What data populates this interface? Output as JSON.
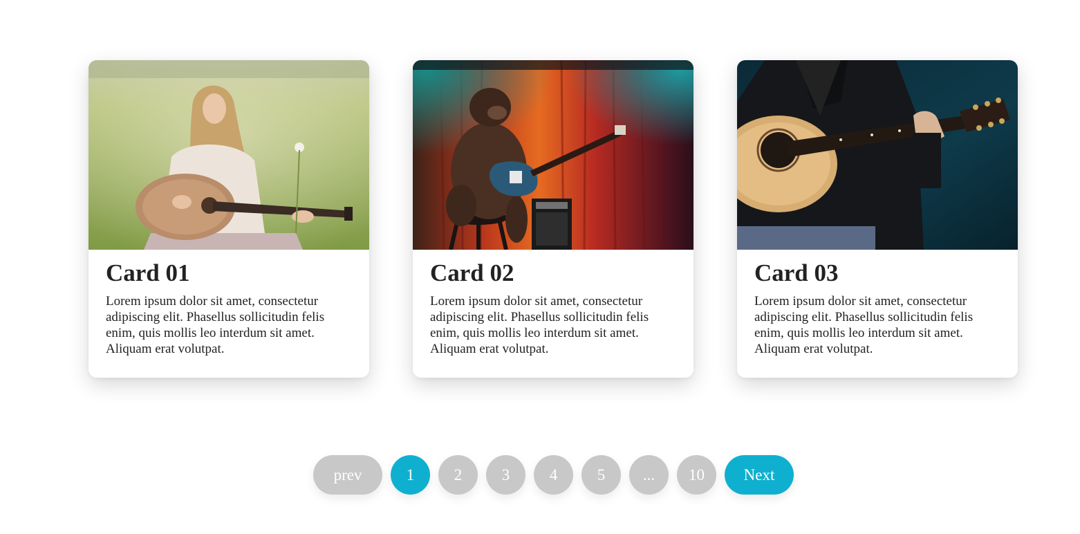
{
  "cards": [
    {
      "title": "Card 01",
      "text": "Lorem ipsum dolor sit amet, consectetur adipiscing elit. Phasellus sollicitudin felis enim, quis mollis leo interdum sit amet. Aliquam erat volutpat."
    },
    {
      "title": "Card 02",
      "text": "Lorem ipsum dolor sit amet, consectetur adipiscing elit. Phasellus sollicitudin felis enim, quis mollis leo interdum sit amet. Aliquam erat volutpat."
    },
    {
      "title": "Card 03",
      "text": "Lorem ipsum dolor sit amet, consectetur adipiscing elit. Phasellus sollicitudin felis enim, quis mollis leo interdum sit amet. Aliquam erat volutpat."
    }
  ],
  "pagination": {
    "prev": "prev",
    "pages": [
      "1",
      "2",
      "3",
      "4",
      "5",
      "...",
      "10"
    ],
    "active_page": "1",
    "next": "Next"
  },
  "colors": {
    "accent": "#0fb0cf",
    "inactive": "#c8c8c8"
  }
}
